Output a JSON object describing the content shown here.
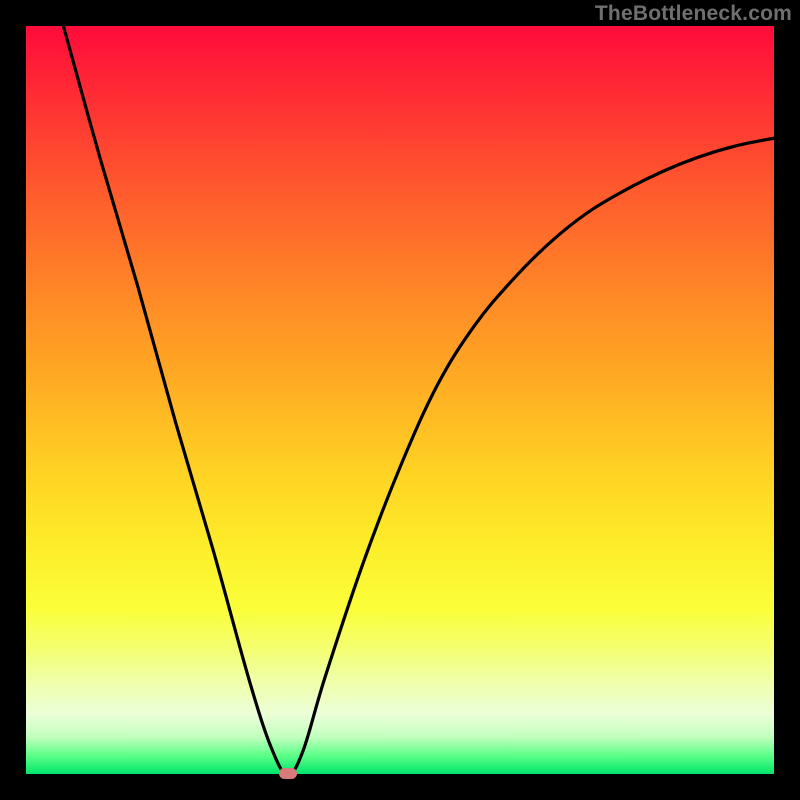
{
  "watermark": "TheBottleneck.com",
  "chart_data": {
    "type": "line",
    "title": "",
    "xlabel": "",
    "ylabel": "",
    "xlim": [
      0,
      100
    ],
    "ylim": [
      0,
      100
    ],
    "grid": false,
    "legend": false,
    "series": [
      {
        "name": "bottleneck-curve",
        "x": [
          5,
          10,
          15,
          20,
          25,
          30,
          33,
          35,
          37,
          40,
          45,
          50,
          55,
          60,
          65,
          70,
          75,
          80,
          85,
          90,
          95,
          100
        ],
        "y": [
          100,
          82,
          65,
          47,
          30,
          12,
          3,
          0,
          3,
          13,
          28,
          41,
          52,
          60,
          66,
          71,
          75,
          78,
          80.5,
          82.5,
          84,
          85
        ]
      }
    ],
    "optimal_point": {
      "x": 35,
      "y": 0
    },
    "gradient_stops": [
      {
        "pos": 0,
        "color": "#ff0b3a"
      },
      {
        "pos": 0.5,
        "color": "#ffd323"
      },
      {
        "pos": 0.78,
        "color": "#faff3a"
      },
      {
        "pos": 1.0,
        "color": "#00e56a"
      }
    ]
  }
}
